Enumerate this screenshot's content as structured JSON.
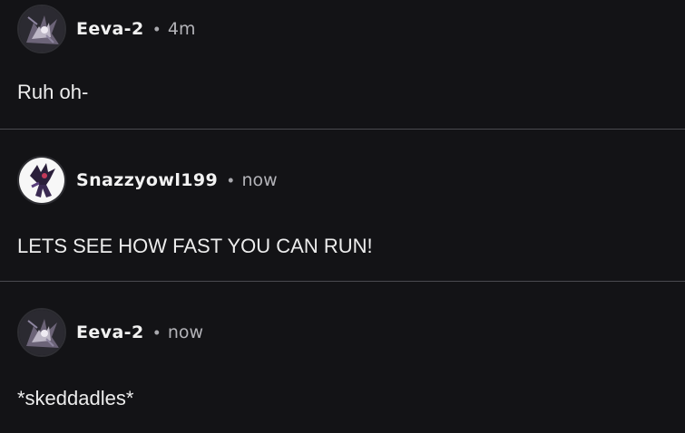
{
  "comments": [
    {
      "username": "Eeva-2",
      "separator": "•",
      "time": "4m",
      "text": "Ruh oh-",
      "avatar_icon": "purple-character-avatar"
    },
    {
      "username": "Snazzyowl199",
      "separator": "•",
      "time": "now",
      "text": "LETS SEE HOW FAST YOU CAN RUN!",
      "avatar_icon": "dark-hedgehog-avatar"
    },
    {
      "username": "Eeva-2",
      "separator": "•",
      "time": "now",
      "text": "*skeddadles*",
      "avatar_icon": "purple-character-avatar"
    }
  ],
  "colors": {
    "background": "#131316",
    "divider": "#4a4a50",
    "username": "#f2f2f2",
    "meta": "#b3b3b8"
  }
}
